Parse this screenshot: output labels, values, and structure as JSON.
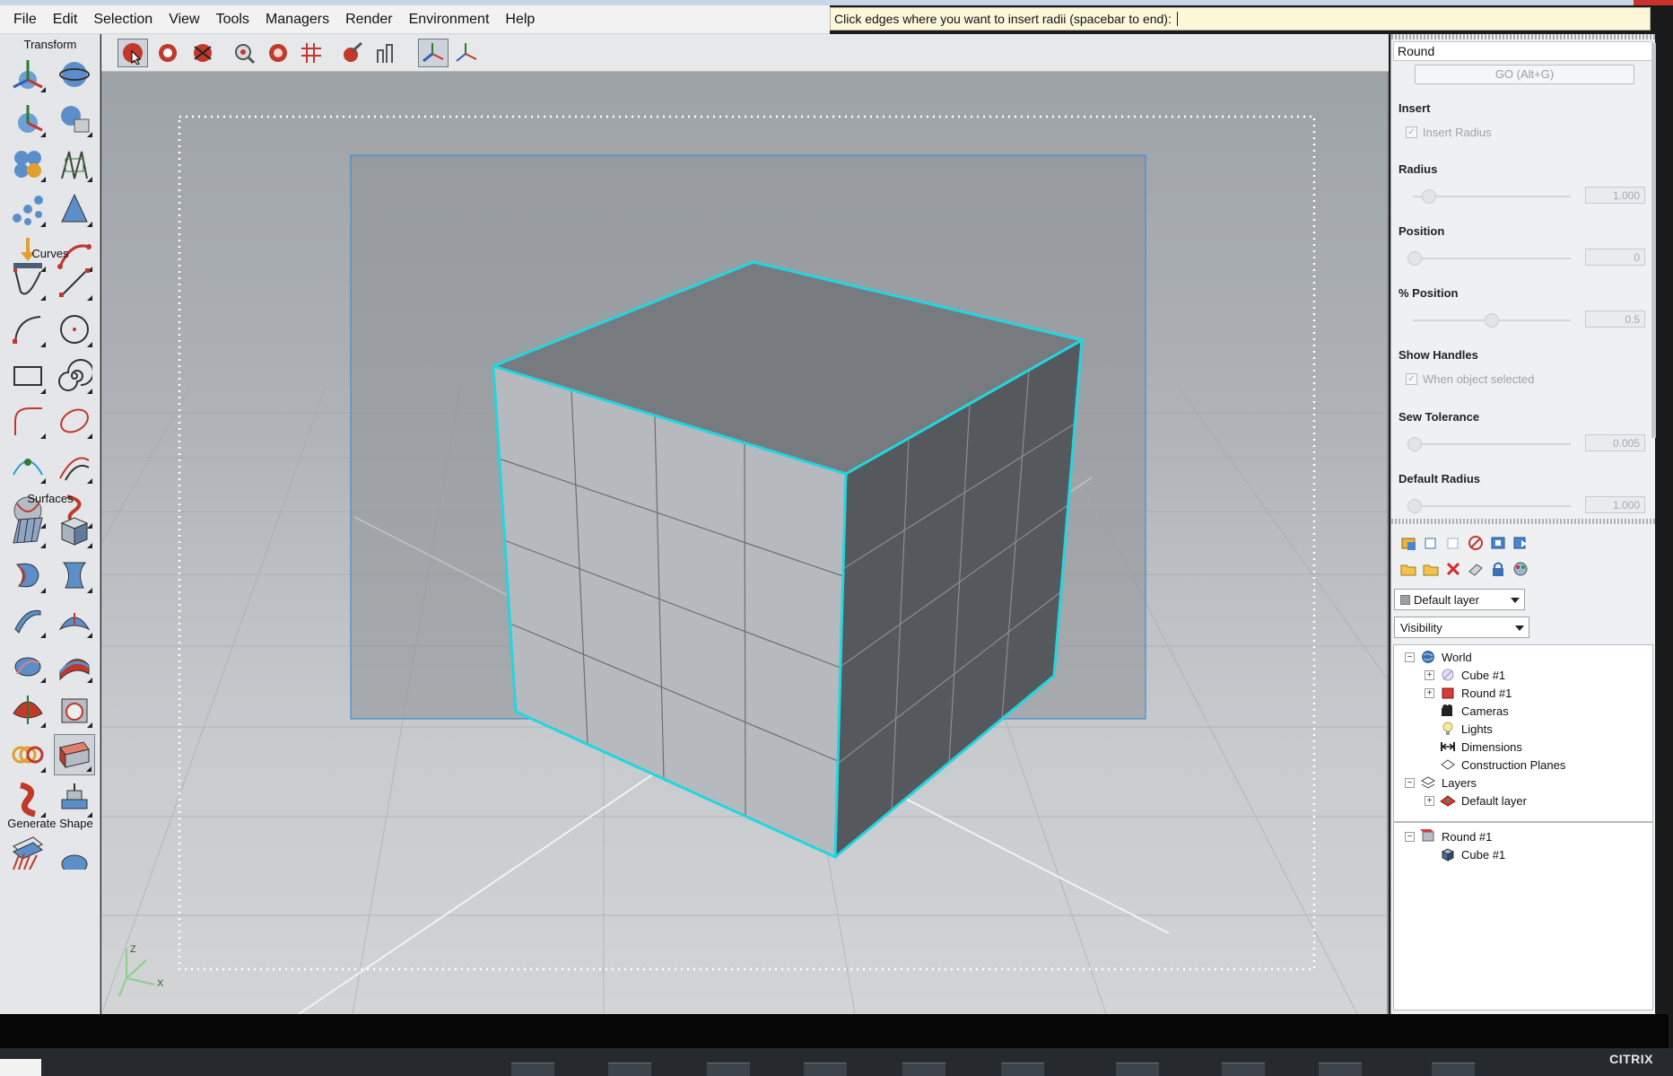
{
  "menubar": {
    "items": [
      "File",
      "Edit",
      "Selection",
      "View",
      "Tools",
      "Managers",
      "Render",
      "Environment",
      "Help"
    ]
  },
  "prompt": {
    "text": "Click edges where you want to insert radii (spacebar to end):"
  },
  "palette": {
    "sections": {
      "transform": "Transform",
      "curves": "Curves",
      "surfaces": "Surfaces",
      "generate": "Generate Shape"
    }
  },
  "properties": {
    "title": "Round",
    "go_button": "GO (Alt+G)",
    "insert_label": "Insert",
    "insert_radius_label": "Insert Radius",
    "radius_label": "Radius",
    "radius_value": "1.000",
    "position_label": "Position",
    "position_value": "0",
    "pct_position_label": "% Position",
    "pct_position_value": "0.5",
    "show_handles_label": "Show Handles",
    "when_selected_label": "When object selected",
    "sew_tolerance_label": "Sew Tolerance",
    "sew_tolerance_value": "0.005",
    "default_radius_label": "Default Radius",
    "default_radius_value": "1.000"
  },
  "layers": {
    "layer_dropdown": "Default layer",
    "filter_dropdown": "Visibility"
  },
  "tree": {
    "world": "World",
    "cube": "Cube #1",
    "round": "Round #1",
    "cameras": "Cameras",
    "lights": "Lights",
    "dimensions": "Dimensions",
    "construction_planes": "Construction Planes",
    "layers": "Layers",
    "default_layer": "Default layer",
    "history_round": "Round #1",
    "history_cube": "Cube #1"
  },
  "axis_labels": {
    "z": "Z",
    "x": "X"
  },
  "taskbar": {
    "brand": "CITRIX"
  },
  "colors": {
    "selection_highlight": "#22d6e0",
    "viewport_bg": "#aeb2b6",
    "prompt_bg": "#fdf7d9"
  }
}
